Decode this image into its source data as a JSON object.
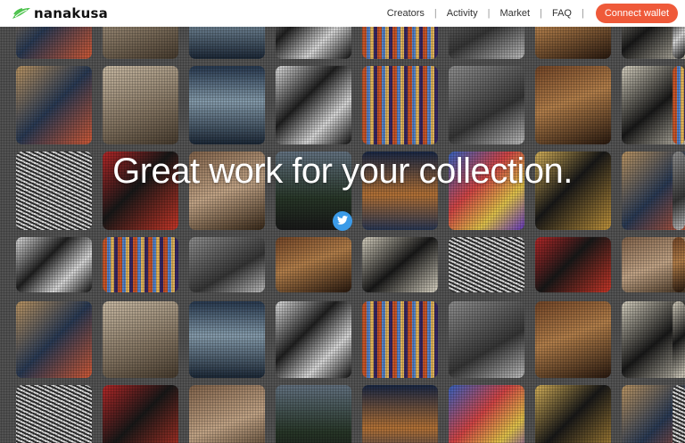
{
  "brand": {
    "name": "nanakusa"
  },
  "nav": {
    "items": [
      "Creators",
      "Activity",
      "Market",
      "FAQ"
    ],
    "separator": "|",
    "connect_label": "Connect wallet"
  },
  "hero": {
    "headline": "Great work for your collection."
  },
  "icons": {
    "logo": "leaf-icon",
    "social": "twitter-icon"
  },
  "colors": {
    "accent": "#ef5a3a",
    "twitter": "#3b9be8",
    "header_bg": "#ffffff"
  },
  "gallery": {
    "artworks": [
      "face-portrait",
      "angel-sculpture",
      "ocean-waves",
      "masked-figure",
      "glitch-stripes",
      "statue-group",
      "classical-painting",
      "street-lamp",
      "wave-lines",
      "red-heart",
      "portrait-photo",
      "forest-night",
      "palace-dome",
      "abstract-brush",
      "x-mask"
    ]
  }
}
